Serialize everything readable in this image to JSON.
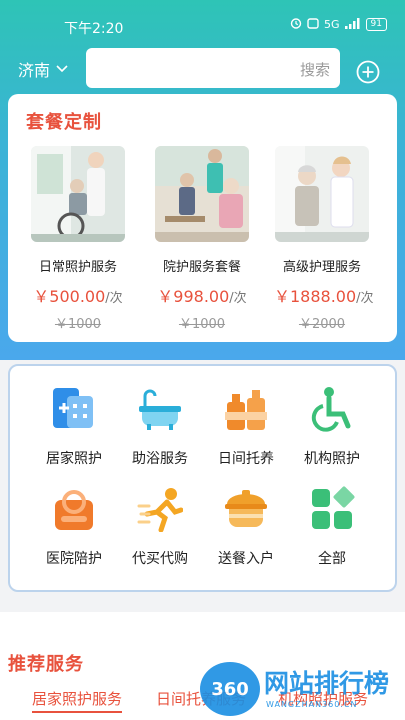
{
  "status_bar": {
    "time": "下午2:20",
    "network": "5G",
    "battery": "91"
  },
  "header": {
    "city": "济南",
    "search_placeholder": "搜索"
  },
  "packages": {
    "title": "套餐定制",
    "items": [
      {
        "name": "日常照护服务",
        "price": "￥500.00",
        "unit": "/次",
        "original": "￥1000"
      },
      {
        "name": "院护服务套餐",
        "price": "￥998.00",
        "unit": "/次",
        "original": "￥1000"
      },
      {
        "name": "高级护理服务",
        "price": "￥1888.00",
        "unit": "/次",
        "original": "￥2000"
      }
    ]
  },
  "services": [
    {
      "label": "居家照护",
      "icon": "home-care-icon"
    },
    {
      "label": "助浴服务",
      "icon": "bathtub-icon"
    },
    {
      "label": "日间托养",
      "icon": "daycare-bottles-icon"
    },
    {
      "label": "机构照护",
      "icon": "wheelchair-icon"
    },
    {
      "label": "医院陪护",
      "icon": "hospital-bag-icon"
    },
    {
      "label": "代买代购",
      "icon": "running-person-icon"
    },
    {
      "label": "送餐入户",
      "icon": "food-pot-icon"
    },
    {
      "label": "全部",
      "icon": "all-grid-icon"
    }
  ],
  "recommend": {
    "title": "推荐服务",
    "tabs": [
      "居家照护服务",
      "日间托养服务",
      "机构照护服务"
    ]
  },
  "watermark": {
    "logo": "360",
    "text": "网站排行榜",
    "sub": "WANGZHAN360.CN"
  },
  "colors": {
    "accent": "#e8523d",
    "teal": "#2ec4b6",
    "blue": "#4aa8ec"
  }
}
